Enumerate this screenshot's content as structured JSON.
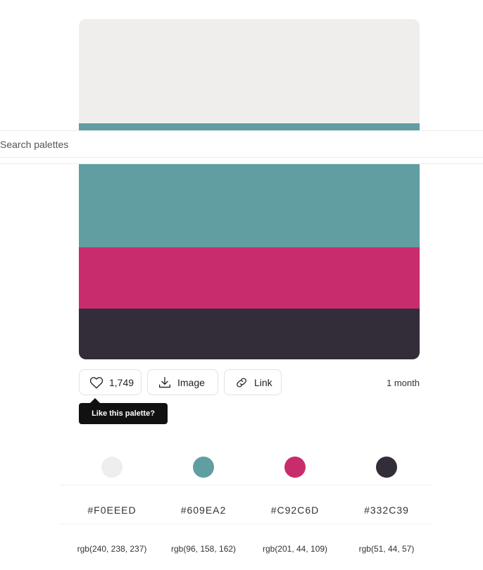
{
  "palette": {
    "colors": [
      {
        "hex": "#F0EEED",
        "rgb": "rgb(240, 238, 237)",
        "value": "#F0EEED"
      },
      {
        "hex": "#609EA2",
        "rgb": "rgb(96, 158, 162)",
        "value": "#609EA2"
      },
      {
        "hex": "#C92C6D",
        "rgb": "rgb(201, 44, 109)",
        "value": "#C92C6D"
      },
      {
        "hex": "#332C39",
        "rgb": "rgb(51, 44, 57)",
        "value": "#332C39"
      }
    ]
  },
  "search": {
    "placeholder": "Search palettes"
  },
  "actions": {
    "like_count": "1,749",
    "image_label": "Image",
    "link_label": "Link",
    "timestamp": "1 month",
    "tooltip": "Like this palette?"
  },
  "icons": {
    "like": "heart-icon",
    "image": "download-icon",
    "link": "link-icon"
  }
}
